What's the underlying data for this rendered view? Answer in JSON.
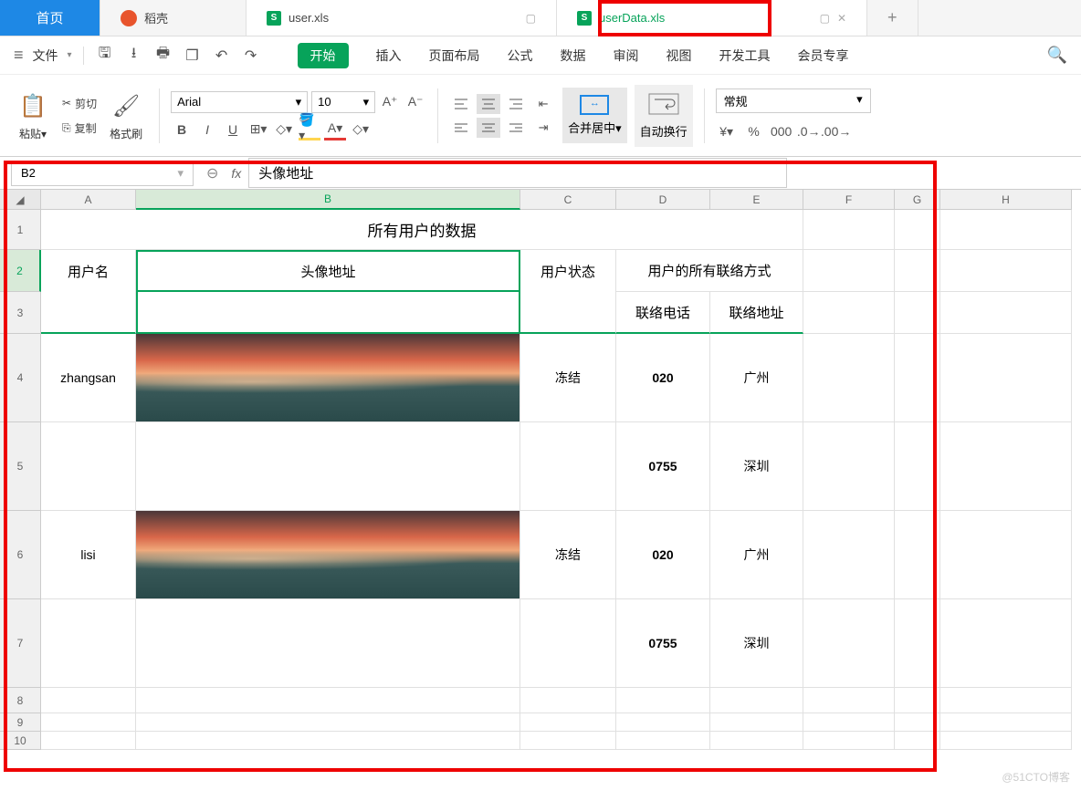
{
  "tabs": {
    "home": "首页",
    "daoke": "稻壳",
    "user_xls": "user.xls",
    "userdata_xls": "userData.xls"
  },
  "menu": {
    "file": "文件",
    "start": "开始",
    "insert": "插入",
    "page_layout": "页面布局",
    "formula": "公式",
    "data": "数据",
    "review": "审阅",
    "view": "视图",
    "dev": "开发工具",
    "member": "会员专享"
  },
  "ribbon": {
    "paste": "粘贴",
    "cut": "剪切",
    "copy": "复制",
    "format_painter": "格式刷",
    "font_name": "Arial",
    "font_size": "10",
    "merge_center": "合并居中",
    "auto_wrap": "自动换行",
    "number_format": "常规"
  },
  "formula_bar": {
    "cell_ref": "B2",
    "value": "头像地址"
  },
  "columns": [
    "A",
    "B",
    "C",
    "D",
    "E",
    "F",
    "G",
    "H"
  ],
  "sheet": {
    "title": "所有用户的数据",
    "h_username": "用户名",
    "h_avatar": "头像地址",
    "h_status": "用户状态",
    "h_contacts": "用户的所有联络方式",
    "h_phone": "联络电话",
    "h_address": "联络地址",
    "rows": [
      {
        "username": "zhangsan",
        "has_img": true,
        "status": "冻结",
        "phone": "020",
        "address": "广州"
      },
      {
        "username": "",
        "has_img": false,
        "status": "",
        "phone": "0755",
        "address": "深圳"
      },
      {
        "username": "lisi",
        "has_img": true,
        "status": "冻结",
        "phone": "020",
        "address": "广州"
      },
      {
        "username": "",
        "has_img": false,
        "status": "",
        "phone": "0755",
        "address": "深圳"
      }
    ]
  },
  "watermark": "@51CTO博客"
}
